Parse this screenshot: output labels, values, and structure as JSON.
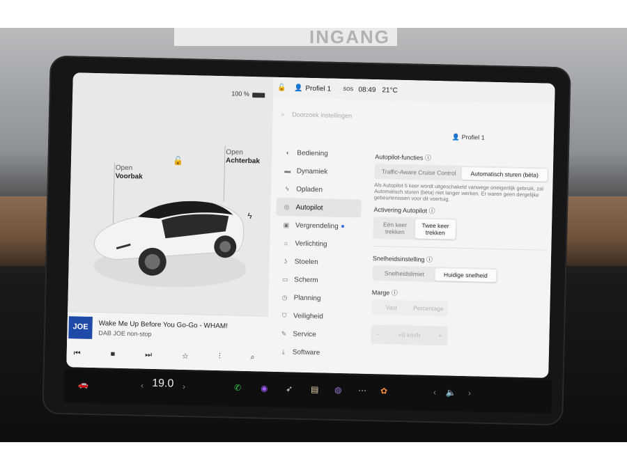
{
  "background": {
    "sign_text": "INGANG"
  },
  "left_pane": {
    "battery": "100 %",
    "front_trunk": {
      "action": "Open",
      "name": "Voorbak"
    },
    "rear_trunk": {
      "action": "Open",
      "name": "Achterbak"
    },
    "media": {
      "art_text": "JOE",
      "title": "Wake Me Up Before You Go-Go - WHAM!",
      "source": "DAB JOE non-stop"
    }
  },
  "status_bar": {
    "profile": "Profiel 1",
    "sos": "SOS",
    "time": "08:49",
    "temperature": "21°C"
  },
  "settings": {
    "search_placeholder": "Doorzoek instellingen",
    "profile": "Profiel 1",
    "nav": [
      {
        "label": "Bediening",
        "icon": "toggle-icon"
      },
      {
        "label": "Dynamiek",
        "icon": "car-icon"
      },
      {
        "label": "Opladen",
        "icon": "bolt-icon"
      },
      {
        "label": "Autopilot",
        "icon": "steering-wheel-icon",
        "active": true
      },
      {
        "label": "Vergrendeling",
        "icon": "lock-icon"
      },
      {
        "label": "Verlichting",
        "icon": "sun-icon"
      },
      {
        "label": "Stoelen",
        "icon": "seat-icon"
      },
      {
        "label": "Scherm",
        "icon": "screen-icon"
      },
      {
        "label": "Planning",
        "icon": "clock-icon"
      },
      {
        "label": "Veiligheid",
        "icon": "shield-icon"
      },
      {
        "label": "Service",
        "icon": "wrench-icon"
      },
      {
        "label": "Software",
        "icon": "download-icon"
      }
    ],
    "autopilot_functions": {
      "title": "Autopilot-functies",
      "options": [
        "Traffic-Aware Cruise Control",
        "Automatisch sturen (bèta)"
      ],
      "selected": "Automatisch sturen (bèta)",
      "description": "Als Autopilot 5 keer wordt uitgeschakeld vanwege oneigenlijk gebruik, zal Automatisch sturen (bèta) niet langer werken. Er waren geen dergelijke gebeurtenissen voor dit voertuig."
    },
    "autopilot_activation": {
      "title": "Activering Autopilot",
      "options": [
        "Eén keer trekken",
        "Twee keer trekken"
      ],
      "selected": "Twee keer trekken"
    },
    "speed_setting": {
      "title": "Snelheidsinstelling",
      "options": [
        "Snelheidslimiet",
        "Huidige snelheid"
      ],
      "selected": "Huidige snelheid"
    },
    "margin": {
      "title": "Marge",
      "options": [
        "Vast",
        "Percentage"
      ],
      "stepper_value": "+0 km/h",
      "minus": "−",
      "plus": "+"
    }
  },
  "taskbar": {
    "temperature": "19.0"
  }
}
